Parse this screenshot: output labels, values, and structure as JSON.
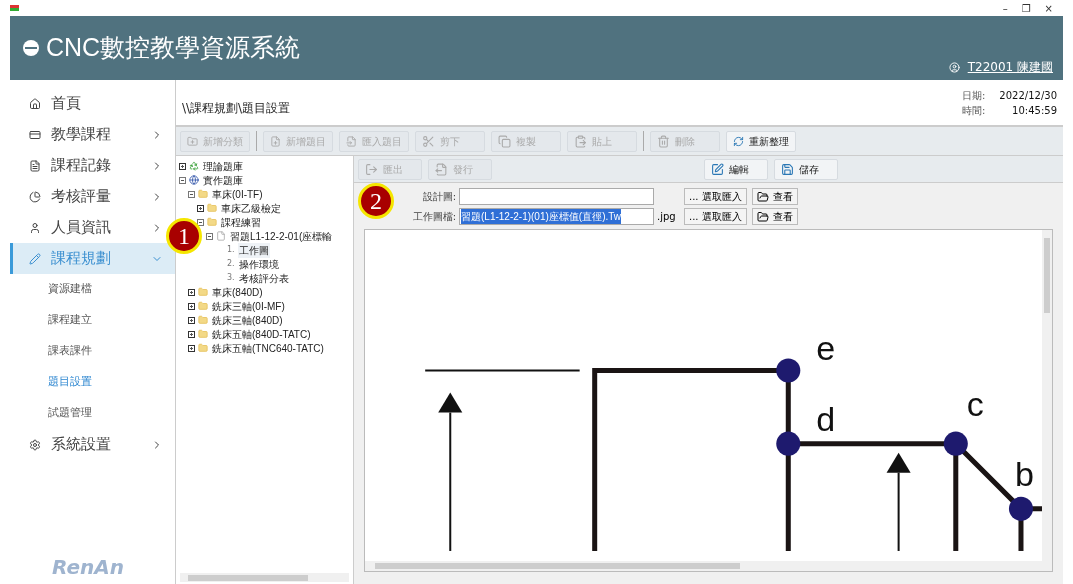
{
  "window": {
    "controls": [
      "–",
      "❐",
      "×"
    ]
  },
  "header": {
    "title": "CNC數控教學資源系統",
    "user": "T22001 陳建國"
  },
  "sidebar": {
    "items": [
      {
        "label": "首頁",
        "kind": "leaf"
      },
      {
        "label": "教學課程",
        "kind": "group",
        "expanded": false
      },
      {
        "label": "課程記錄",
        "kind": "group",
        "expanded": false
      },
      {
        "label": "考核評量",
        "kind": "group",
        "expanded": false
      },
      {
        "label": "人員資訊",
        "kind": "group",
        "expanded": false
      },
      {
        "label": "課程規劃",
        "kind": "group",
        "expanded": true,
        "selected": true,
        "children": [
          {
            "label": "資源建檔",
            "selected": false
          },
          {
            "label": "課程建立",
            "selected": false
          },
          {
            "label": "課表課件",
            "selected": false
          },
          {
            "label": "題目設置",
            "selected": true
          },
          {
            "label": "試題管理",
            "selected": false
          }
        ]
      },
      {
        "label": "系統設置",
        "kind": "group",
        "expanded": false
      }
    ],
    "brand": "RenAn"
  },
  "breadcrumb": "\\\\課程規劃\\題目設置",
  "datetime": [
    {
      "label": "日期:",
      "value": "2022/12/30"
    },
    {
      "label": "時間:",
      "value": "10:45:59"
    }
  ],
  "toolbar": [
    {
      "label": "新增分類",
      "disabled": true
    },
    {
      "label": "新增題目",
      "disabled": true
    },
    {
      "label": "匯入題目",
      "disabled": true
    },
    {
      "label": "剪下",
      "disabled": true
    },
    {
      "label": "複製",
      "disabled": true
    },
    {
      "label": "貼上",
      "disabled": true
    },
    {
      "label": "刪除",
      "disabled": true
    },
    {
      "label": "重新整理",
      "disabled": false
    }
  ],
  "tree": [
    {
      "label": "理論題庫",
      "kind": "bank-green",
      "expanded": false
    },
    {
      "label": "實作題庫",
      "kind": "bank-blue",
      "expanded": true,
      "children": [
        {
          "label": "車床(0I-TF)",
          "kind": "folder",
          "expanded": true,
          "children": [
            {
              "label": "車床乙級檢定",
              "kind": "folder",
              "expanded": false
            },
            {
              "label": "課程練習",
              "kind": "folder",
              "expanded": true,
              "children": [
                {
                  "label": "習題L1-12-2-01(座標輸",
                  "kind": "document",
                  "expanded": true,
                  "children": [
                    {
                      "label": "工作圖",
                      "number": "1.",
                      "kind": "step",
                      "selected": true
                    },
                    {
                      "label": "操作環境",
                      "number": "2.",
                      "kind": "step",
                      "selected": false
                    },
                    {
                      "label": "考核評分表",
                      "number": "3.",
                      "kind": "step",
                      "selected": false
                    }
                  ]
                }
              ]
            }
          ]
        },
        {
          "label": "車床(840D)",
          "kind": "folder",
          "expanded": false
        },
        {
          "label": "銑床三軸(0I-MF)",
          "kind": "folder",
          "expanded": false
        },
        {
          "label": "銑床三軸(840D)",
          "kind": "folder",
          "expanded": false
        },
        {
          "label": "銑床五軸(840D-TATC)",
          "kind": "folder",
          "expanded": false
        },
        {
          "label": "銑床五軸(TNC640-TATC)",
          "kind": "folder",
          "expanded": false
        }
      ]
    }
  ],
  "subtoolbar": [
    {
      "label": "匯出",
      "disabled": true
    },
    {
      "label": "發行",
      "disabled": true
    },
    {
      "label": "編輯",
      "disabled": false
    },
    {
      "label": "儲存",
      "disabled": false
    }
  ],
  "fields": [
    {
      "label": "設計圖:",
      "buttons": [
        "... 選取匯入",
        "查看"
      ]
    },
    {
      "label": "工作圖檔:",
      "value": "習題(L1-12-2-1)(01)座標值(直徑).Tw",
      "suffix": ".jpg",
      "buttons": [
        "... 選取匯入",
        "查看"
      ]
    }
  ],
  "drawing": {
    "point_labels": [
      "e",
      "d",
      "c",
      "b"
    ]
  },
  "callouts": [
    {
      "label": "1"
    },
    {
      "label": "2"
    }
  ]
}
